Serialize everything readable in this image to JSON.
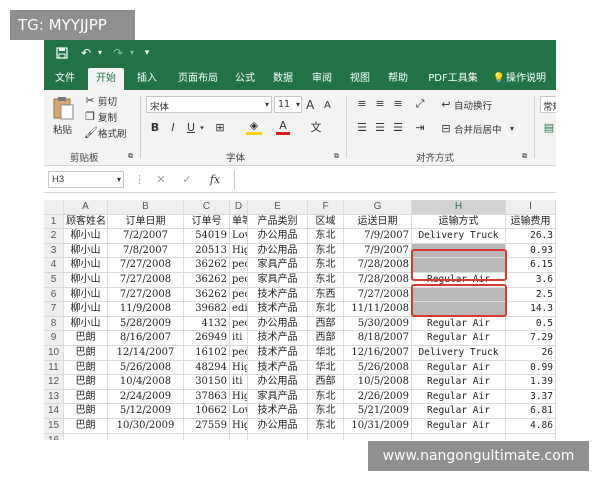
{
  "watermarks": {
    "top_left": "TG: MYYJJPP",
    "bottom_right": "www.nangongultimate.com"
  },
  "qat": {
    "save_icon": "save-icon",
    "undo_icon": "undo-icon",
    "redo_icon": "redo-icon",
    "customize_icon": "customize-icon"
  },
  "tabs": [
    "文件",
    "开始",
    "插入",
    "页面布局",
    "公式",
    "数据",
    "审阅",
    "视图",
    "帮助",
    "PDF工具集",
    "操作说明"
  ],
  "ribbon": {
    "paste": "粘贴",
    "cut": "剪切",
    "copy": "复制",
    "format_painter": "格式刷",
    "clipboard_group": "剪贴板",
    "font_name": "宋体",
    "font_size": "11",
    "grow_font": "A",
    "shrink_font": "A",
    "bold": "B",
    "italic": "I",
    "underline": "U",
    "font_color": "A",
    "phonetic": "文",
    "font_group": "字体",
    "wrap_text": "自动换行",
    "merge_center": "合并后居中",
    "align_group": "对齐方式",
    "number_format": "常规"
  },
  "formula_bar": {
    "name_box": "H3",
    "cancel": "✕",
    "enter": "✓",
    "fx": "fx",
    "content": ""
  },
  "sheet": {
    "columns": [
      "A",
      "B",
      "C",
      "D",
      "E",
      "F",
      "G",
      "H",
      "I"
    ],
    "selected_column": "H",
    "header_row": [
      "顾客姓名",
      "订单日期",
      "订单号",
      "单等",
      "产品类别",
      "区域",
      "运送日期",
      "运输方式",
      "运输费用"
    ],
    "rows": [
      [
        "柳小山",
        "7/2/2007",
        "54019",
        "Low",
        "办公用品",
        "东北",
        "7/9/2007",
        "Delivery Truck",
        "26.3"
      ],
      [
        "柳小山",
        "7/8/2007",
        "20513",
        "Hig",
        "办公用品",
        "东北",
        "7/9/2007",
        "",
        "0.93"
      ],
      [
        "柳小山",
        "7/27/2008",
        "36262",
        "pec",
        "家具产品",
        "东北",
        "7/28/2008",
        "",
        "6.15"
      ],
      [
        "柳小山",
        "7/27/2008",
        "36262",
        "pec",
        "家具产品",
        "东北",
        "7/28/2008",
        "Regular Air",
        "3.6"
      ],
      [
        "柳小山",
        "7/27/2008",
        "36262",
        "pec",
        "技术产品",
        "东西",
        "7/27/2008",
        "",
        "2.5"
      ],
      [
        "柳小山",
        "11/9/2008",
        "39682",
        "edi",
        "技术产品",
        "东北",
        "11/11/2008",
        "",
        "14.3"
      ],
      [
        "柳小山",
        "5/28/2009",
        "4132",
        "pec",
        "办公用品",
        "西部",
        "5/30/2009",
        "Regular Air",
        "0.5"
      ],
      [
        "巴朗",
        "8/16/2007",
        "26949",
        "iti",
        "技术产品",
        "西部",
        "8/18/2007",
        "Regular Air",
        "7.29"
      ],
      [
        "巴朗",
        "12/14/2007",
        "16102",
        "pec",
        "技术产品",
        "华北",
        "12/16/2007",
        "Delivery Truck",
        "26"
      ],
      [
        "巴朗",
        "5/26/2008",
        "48294",
        "Hig",
        "技术产品",
        "华北",
        "5/26/2008",
        "Regular Air",
        "0.99"
      ],
      [
        "巴朗",
        "10/4/2008",
        "30150",
        "iti",
        "办公用品",
        "西部",
        "10/5/2008",
        "Regular Air",
        "1.39"
      ],
      [
        "巴朗",
        "2/24/2009",
        "37863",
        "Hig",
        "家具产品",
        "东北",
        "2/26/2009",
        "Regular Air",
        "3.37"
      ],
      [
        "巴朗",
        "5/12/2009",
        "10662",
        "Low",
        "技术产品",
        "东北",
        "5/21/2009",
        "Regular Air",
        "6.81"
      ],
      [
        "巴朗",
        "10/30/2009",
        "27559",
        "Hig",
        "办公用品",
        "东北",
        "10/31/2009",
        "Regular Air",
        "4.86"
      ],
      [
        "",
        "",
        "",
        "",
        "",
        "",
        "",
        "",
        ""
      ]
    ]
  },
  "colors": {
    "excel_green": "#217346",
    "highlight_red": "#d93a32",
    "ribbon_bg": "#f3f3f3"
  }
}
